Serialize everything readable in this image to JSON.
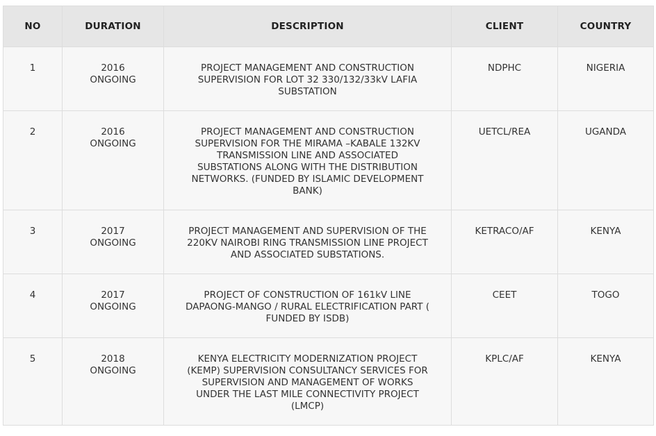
{
  "headers": {
    "no": "NO",
    "duration": "DURATION",
    "description": "DESCRIPTION",
    "client": "CLIENT",
    "country": "COUNTRY"
  },
  "rows": [
    {
      "no": "1",
      "year": "2016",
      "status": "ONGOING",
      "description": "PROJECT MANAGEMENT AND CONSTRUCTION SUPERVISION FOR LOT 32 330/132/33kV LAFIA SUBSTATION",
      "client": "NDPHC",
      "country": "NIGERIA"
    },
    {
      "no": "2",
      "year": "2016",
      "status": "ONGOING",
      "description": "PROJECT MANAGEMENT AND CONSTRUCTION SUPERVISION FOR THE MIRAMA –KABALE 132KV TRANSMISSION LINE AND ASSOCIATED SUBSTATIONS ALONG WITH THE DISTRIBUTION NETWORKS. (FUNDED BY ISLAMIC DEVELOPMENT BANK)",
      "client": "UETCL/REA",
      "country": "UGANDA"
    },
    {
      "no": "3",
      "year": "2017",
      "status": "ONGOING",
      "description": "PROJECT MANAGEMENT AND SUPERVISION OF THE 220KV NAIROBI RING TRANSMISSION LINE PROJECT AND ASSOCIATED SUBSTATIONS.",
      "client": "KETRACO/AF",
      "country": "KENYA"
    },
    {
      "no": "4",
      "year": "2017",
      "status": "ONGOING",
      "description": "PROJECT OF CONSTRUCTION OF 161kV LINE DAPAONG-MANGO / RURAL ELECTRIFICATION PART ( FUNDED BY ISDB)",
      "client": "CEET",
      "country": "TOGO"
    },
    {
      "no": "5",
      "year": "2018",
      "status": "ONGOING",
      "description": "KENYA ELECTRICITY MODERNIZATION PROJECT (KEMP) SUPERVISION CONSULTANCY SERVICES FOR SUPERVISION AND MANAGEMENT OF WORKS UNDER THE LAST MILE CONNECTIVITY PROJECT (LMCP)",
      "client": "KPLC/AF",
      "country": "KENYA"
    }
  ]
}
